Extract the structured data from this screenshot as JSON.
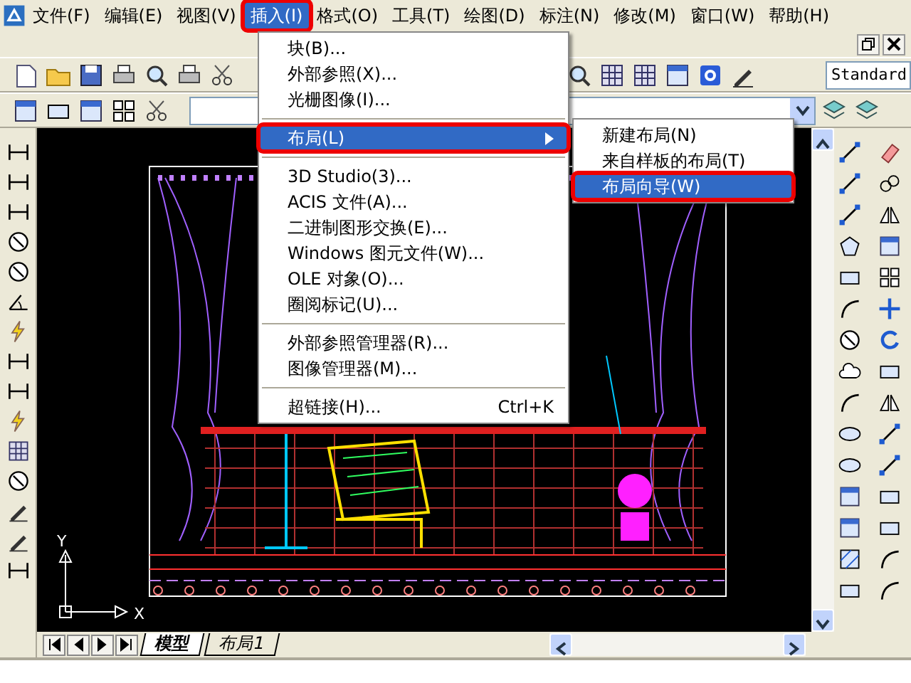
{
  "menubar": [
    {
      "label": "文件(F)",
      "selected": false,
      "callout": false
    },
    {
      "label": "编辑(E)",
      "selected": false,
      "callout": false
    },
    {
      "label": "视图(V)",
      "selected": false,
      "callout": false
    },
    {
      "label": "插入(I)",
      "selected": true,
      "callout": true
    },
    {
      "label": "格式(O)",
      "selected": false,
      "callout": false
    },
    {
      "label": "工具(T)",
      "selected": false,
      "callout": false
    },
    {
      "label": "绘图(D)",
      "selected": false,
      "callout": false
    },
    {
      "label": "标注(N)",
      "selected": false,
      "callout": false
    },
    {
      "label": "修改(M)",
      "selected": false,
      "callout": false
    },
    {
      "label": "窗口(W)",
      "selected": false,
      "callout": false
    },
    {
      "label": "帮助(H)",
      "selected": false,
      "callout": false
    }
  ],
  "text_style": {
    "value": "Standard"
  },
  "insert_menu": [
    {
      "kind": "item",
      "label": "块(B)...",
      "selected": false,
      "callout": false
    },
    {
      "kind": "item",
      "label": "外部参照(X)...",
      "selected": false,
      "callout": false
    },
    {
      "kind": "item",
      "label": "光栅图像(I)...",
      "selected": false,
      "callout": false
    },
    {
      "kind": "separator"
    },
    {
      "kind": "submenu",
      "label": "布局(L)",
      "selected": true,
      "callout": true
    },
    {
      "kind": "separator"
    },
    {
      "kind": "item",
      "label": "3D Studio(3)...",
      "selected": false,
      "callout": false
    },
    {
      "kind": "item",
      "label": "ACIS 文件(A)...",
      "selected": false,
      "callout": false
    },
    {
      "kind": "item",
      "label": "二进制图形交换(E)...",
      "selected": false,
      "callout": false
    },
    {
      "kind": "item",
      "label": "Windows 图元文件(W)...",
      "selected": false,
      "callout": false
    },
    {
      "kind": "item",
      "label": "OLE 对象(O)...",
      "selected": false,
      "callout": false
    },
    {
      "kind": "item",
      "label": "圈阅标记(U)...",
      "selected": false,
      "callout": false
    },
    {
      "kind": "separator"
    },
    {
      "kind": "item",
      "label": "外部参照管理器(R)...",
      "selected": false,
      "callout": false
    },
    {
      "kind": "item",
      "label": "图像管理器(M)...",
      "selected": false,
      "callout": false
    },
    {
      "kind": "separator"
    },
    {
      "kind": "item",
      "label": "超链接(H)...",
      "shortcut": "Ctrl+K",
      "selected": false,
      "callout": false
    }
  ],
  "layout_submenu": [
    {
      "label": "新建布局(N)",
      "selected": false,
      "callout": false
    },
    {
      "label": "来自样板的布局(T)",
      "selected": false,
      "callout": false
    },
    {
      "label": "布局向导(W)",
      "selected": true,
      "callout": true
    }
  ],
  "ucs": {
    "x_label": "X",
    "y_label": "Y"
  },
  "layout_tabs": [
    {
      "label": "模型",
      "selected": true
    },
    {
      "label": "布局1",
      "selected": false
    }
  ]
}
